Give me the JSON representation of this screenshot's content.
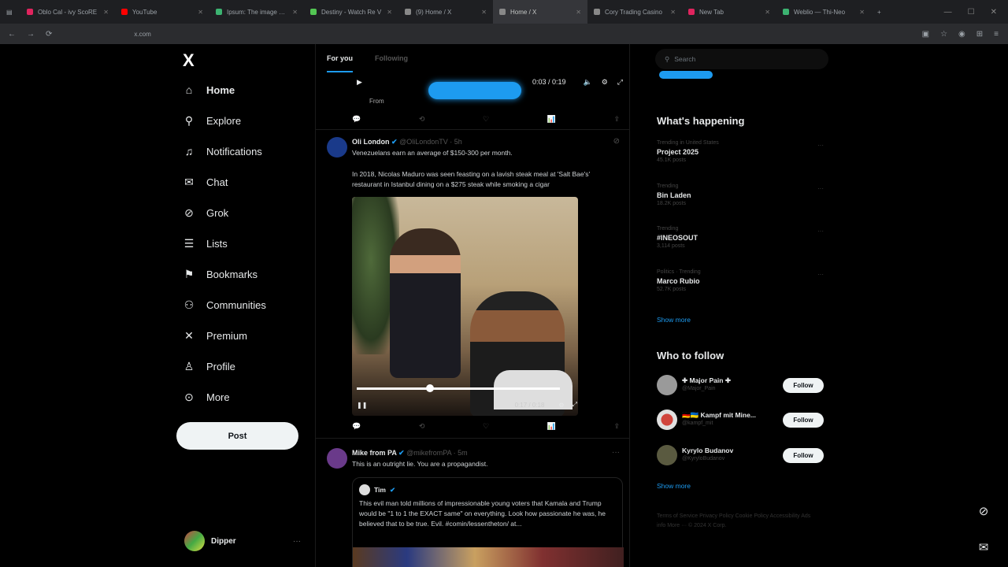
{
  "browser": {
    "tabs": [
      {
        "label": "Oblo Cal - ivy ScoRE",
        "color": "#e0245e",
        "active": false
      },
      {
        "label": "YouTube",
        "color": "#ff0000",
        "active": false
      },
      {
        "label": "Ipsum: The image of P",
        "color": "#3cb371",
        "active": false
      },
      {
        "label": "Destiny - Watch Re V",
        "color": "#53c653",
        "active": false
      },
      {
        "label": "(9) Home / X",
        "color": "#888888",
        "active": false
      },
      {
        "label": "Home / X",
        "color": "#888888",
        "active": true
      },
      {
        "label": "Cory Trading Casino",
        "color": "#888888",
        "active": false
      },
      {
        "label": "New Tab",
        "color": "#e0245e",
        "active": false
      },
      {
        "label": "Weblio — Thi-Neo",
        "color": "#3cb371",
        "active": false
      }
    ],
    "url": "x.com"
  },
  "nav": {
    "logo": "X",
    "items": [
      {
        "label": "Home",
        "icon": "home-icon",
        "glyph": "⌂"
      },
      {
        "label": "Explore",
        "icon": "search-icon",
        "glyph": "⚲"
      },
      {
        "label": "Notifications",
        "icon": "bell-icon",
        "glyph": "🔔"
      },
      {
        "label": "Chat",
        "icon": "envelope-icon",
        "glyph": "✉"
      },
      {
        "label": "Grok",
        "icon": "grok-icon",
        "glyph": "⊘"
      },
      {
        "label": "Lists",
        "icon": "list-icon",
        "glyph": "☰"
      },
      {
        "label": "Bookmarks",
        "icon": "bookmark-icon",
        "glyph": "🔖"
      },
      {
        "label": "Communities",
        "icon": "people-icon",
        "glyph": "👥"
      },
      {
        "label": "Premium",
        "icon": "x-premium-icon",
        "glyph": "✕"
      },
      {
        "label": "Profile",
        "icon": "person-icon",
        "glyph": "👤"
      },
      {
        "label": "More",
        "icon": "more-circle-icon",
        "glyph": "⊙"
      }
    ],
    "post_label": "Post",
    "account_name": "Dipper",
    "account_more": "···"
  },
  "timeline": {
    "tabs": [
      "For you",
      "Following"
    ],
    "top_video": {
      "time": "0:03 / 0:19",
      "source": "From"
    },
    "tweet1": {
      "name": "Oli London",
      "handle": "@OliLondonTV · 5h",
      "text1": "Venezuelans earn an average of $150-300 per month.",
      "text2": "In 2018, Nicolas Maduro was seen feasting on a lavish steak meal at 'Salt Bae's' restaurant in Istanbul dining on a $275 steak while smoking a cigar",
      "video_time": "0:17 / 0:18",
      "video_progress": 0.36,
      "video_buffer": 1.0
    },
    "tweet2": {
      "name": "Mike from PA",
      "handle": "@mikefromPA · 5m",
      "text": "This is an outright lie. You are a propagandist.",
      "quote_name": "Tim",
      "quote_text": "This evil man told millions of impressionable young voters that Kamala and Trump would be \"1 to 1 the EXACT same\" on everything. Look how passionate he was, he believed that to be true. Evil. #comin/lessentheton/ at..."
    }
  },
  "sidebar": {
    "search_placeholder": "Search",
    "whats_happening_title": "What's happening",
    "trends": [
      {
        "context": "Trending in United States",
        "name": "Project 2025",
        "count": "45.1K posts"
      },
      {
        "context": "Trending",
        "name": "Bin Laden",
        "count": "18.2K posts"
      },
      {
        "context": "Trending",
        "name": "#INEOSOUT",
        "count": "3,114 posts"
      },
      {
        "context": "Politics · Trending",
        "name": "Marco Rubio",
        "count": "52.7K posts"
      }
    ],
    "trends_show_more": "Show more",
    "who_to_follow_title": "Who to follow",
    "follow_label": "Follow",
    "suggestions": [
      {
        "name": "✚ Major Pain ✚",
        "handle": "@Major_Pain"
      },
      {
        "name": "🇩🇪🇺🇦 Kampf mit Mine...",
        "handle": "@kampf_mit"
      },
      {
        "name": "Kyrylo Budanov",
        "handle": "@KyryloBudanov"
      }
    ],
    "follow_show_more": "Show more",
    "footer": "Terms of Service  Privacy Policy  Cookie Policy  Accessibility  Ads info  More ···  © 2024 X Corp."
  },
  "colors": {
    "accent": "#1d9bf0",
    "background": "#000000"
  }
}
